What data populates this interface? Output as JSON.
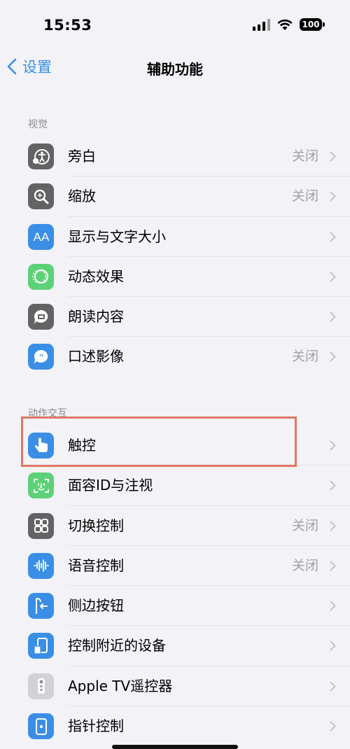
{
  "status": {
    "time": "15:53",
    "battery": "100"
  },
  "nav": {
    "back_label": "设置",
    "title": "辅助功能"
  },
  "sections": [
    {
      "header": "视觉",
      "items": [
        {
          "label": "旁白",
          "value": "关闭",
          "icon": "voiceover-icon",
          "color": "#636366"
        },
        {
          "label": "缩放",
          "value": "关闭",
          "icon": "zoom-icon",
          "color": "#636366"
        },
        {
          "label": "显示与文字大小",
          "value": "",
          "icon": "text-size-icon",
          "color": "#3a8ee6"
        },
        {
          "label": "动态效果",
          "value": "",
          "icon": "motion-icon",
          "color": "#5dd177"
        },
        {
          "label": "朗读内容",
          "value": "",
          "icon": "spoken-content-icon",
          "color": "#636366"
        },
        {
          "label": "口述影像",
          "value": "关闭",
          "icon": "audio-description-icon",
          "color": "#3a8ee6"
        }
      ]
    },
    {
      "header": "动作交互",
      "items": [
        {
          "label": "触控",
          "value": "",
          "icon": "touch-icon",
          "color": "#3a8ee6"
        },
        {
          "label": "面容ID与注视",
          "value": "",
          "icon": "face-id-icon",
          "color": "#5dd177"
        },
        {
          "label": "切换控制",
          "value": "关闭",
          "icon": "switch-control-icon",
          "color": "#636366"
        },
        {
          "label": "语音控制",
          "value": "关闭",
          "icon": "voice-control-icon",
          "color": "#3a8ee6"
        },
        {
          "label": "侧边按钮",
          "value": "",
          "icon": "side-button-icon",
          "color": "#3a8ee6"
        },
        {
          "label": "控制附近的设备",
          "value": "",
          "icon": "nearby-devices-icon",
          "color": "#3a8ee6"
        },
        {
          "label": "Apple TV遥控器",
          "value": "",
          "icon": "apple-tv-remote-icon",
          "color": "#d1d1d6"
        },
        {
          "label": "指针控制",
          "value": "",
          "icon": "pointer-control-icon",
          "color": "#3a8ee6"
        }
      ]
    }
  ]
}
